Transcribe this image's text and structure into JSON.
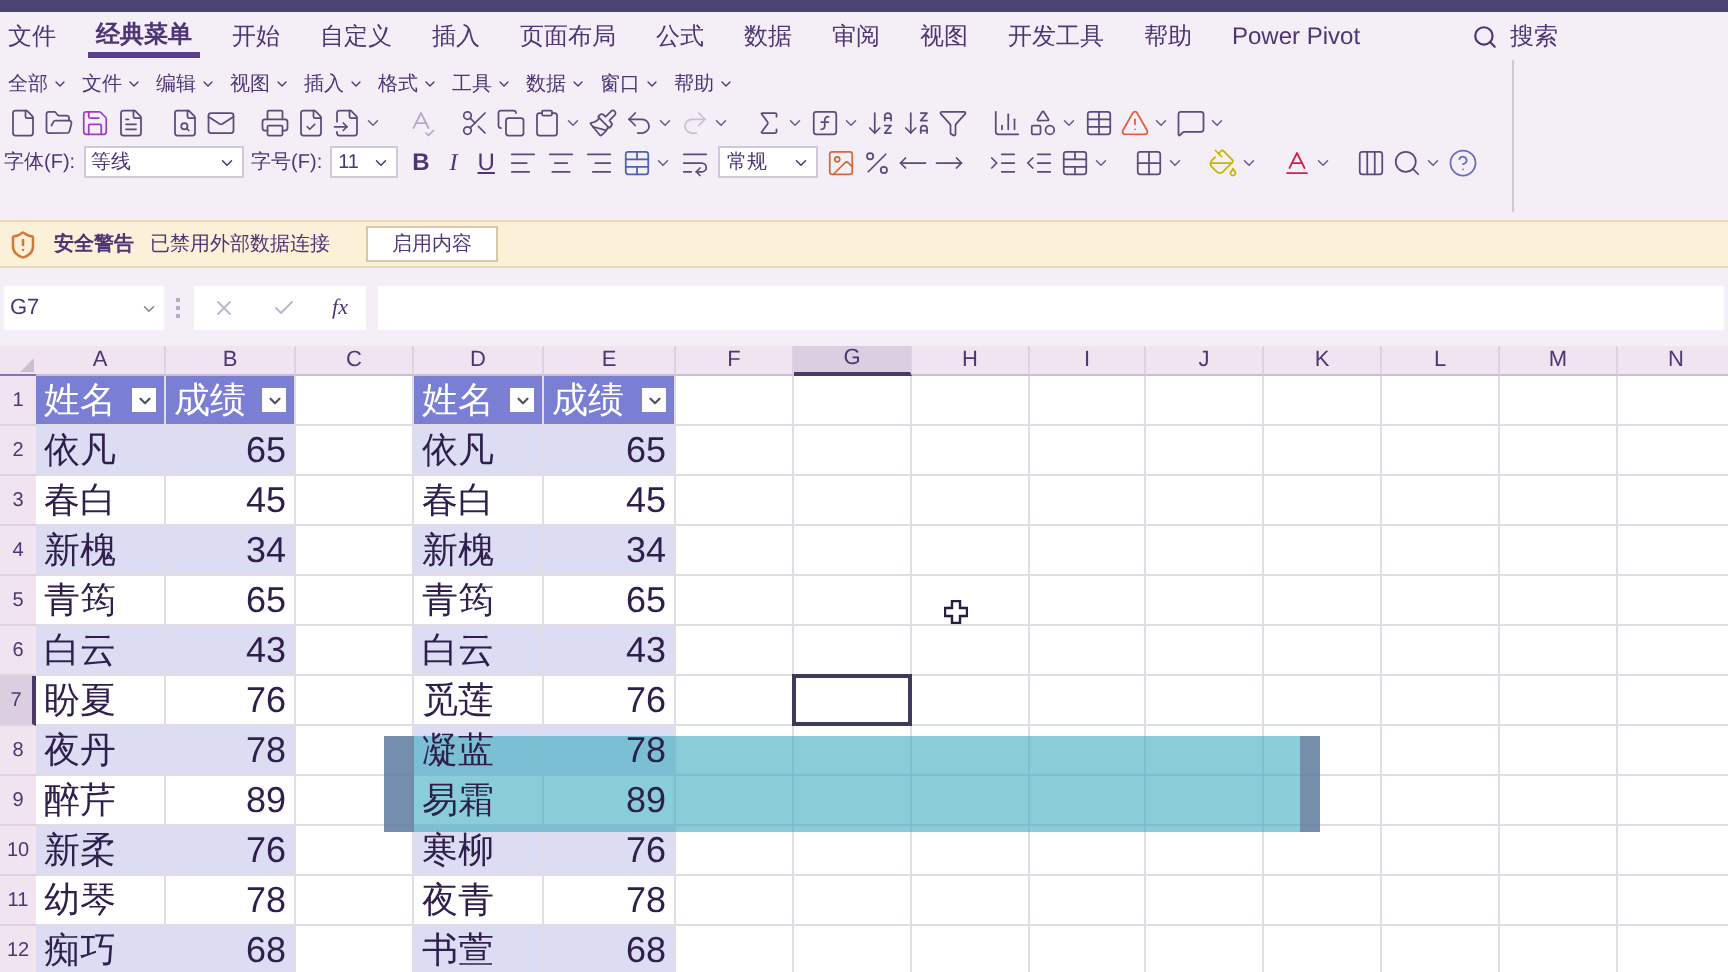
{
  "ribbon_tabs": [
    {
      "label": "文件",
      "selected": false
    },
    {
      "label": "经典菜单",
      "selected": true
    },
    {
      "label": "开始",
      "selected": false
    },
    {
      "label": "自定义",
      "selected": false
    },
    {
      "label": "插入",
      "selected": false
    },
    {
      "label": "页面布局",
      "selected": false
    },
    {
      "label": "公式",
      "selected": false
    },
    {
      "label": "数据",
      "selected": false
    },
    {
      "label": "审阅",
      "selected": false
    },
    {
      "label": "视图",
      "selected": false
    },
    {
      "label": "开发工具",
      "selected": false
    },
    {
      "label": "帮助",
      "selected": false
    },
    {
      "label": "Power Pivot",
      "selected": false
    }
  ],
  "search": {
    "label": "搜索"
  },
  "classic_menu": [
    "全部",
    "文件",
    "编辑",
    "视图",
    "插入",
    "格式",
    "工具",
    "数据",
    "窗口",
    "帮助"
  ],
  "font_toolbar": {
    "font_label": "字体(F):",
    "font": "等线",
    "size_label": "字号(F):",
    "size": "11",
    "bold": "B",
    "italic": "I",
    "underline": "U",
    "number_format": "常规"
  },
  "security_bar": {
    "title": "安全警告",
    "message": "已禁用外部数据连接",
    "button": "启用内容"
  },
  "formula_bar": {
    "name_box": "G7",
    "function_label": "fx"
  },
  "sheet": {
    "columns": [
      {
        "label": "A",
        "selected": false
      },
      {
        "label": "B",
        "selected": false
      },
      {
        "label": "C",
        "selected": false
      },
      {
        "label": "D",
        "selected": false
      },
      {
        "label": "E",
        "selected": false
      },
      {
        "label": "F",
        "selected": false
      },
      {
        "label": "G",
        "selected": true
      },
      {
        "label": "H",
        "selected": false
      },
      {
        "label": "I",
        "selected": false
      },
      {
        "label": "J",
        "selected": false
      },
      {
        "label": "K",
        "selected": false
      },
      {
        "label": "L",
        "selected": false
      },
      {
        "label": "M",
        "selected": false
      },
      {
        "label": "N",
        "selected": false
      }
    ],
    "rows": [
      {
        "label": "1",
        "selected": false
      },
      {
        "label": "2",
        "selected": false
      },
      {
        "label": "3",
        "selected": false
      },
      {
        "label": "4",
        "selected": false
      },
      {
        "label": "5",
        "selected": false
      },
      {
        "label": "6",
        "selected": false
      },
      {
        "label": "7",
        "selected": true
      },
      {
        "label": "8",
        "selected": false
      },
      {
        "label": "9",
        "selected": false
      },
      {
        "label": "10",
        "selected": false
      },
      {
        "label": "11",
        "selected": false
      },
      {
        "label": "12",
        "selected": false
      }
    ],
    "tables": [
      {
        "banded": true,
        "filter": true,
        "header": [
          "姓名",
          "成绩"
        ],
        "rows": [
          [
            "依凡",
            "65"
          ],
          [
            "春白",
            "45"
          ],
          [
            "新槐",
            "34"
          ],
          [
            "青筠",
            "65"
          ],
          [
            "白云",
            "43"
          ],
          [
            "盼夏",
            "76"
          ],
          [
            "夜丹",
            "78"
          ],
          [
            "醉芹",
            "89"
          ],
          [
            "新柔",
            "76"
          ],
          [
            "幼琴",
            "78"
          ],
          [
            "痴巧",
            "68"
          ]
        ]
      },
      {
        "banded": true,
        "filter": true,
        "header": [
          "姓名",
          "成绩"
        ],
        "rows": [
          [
            "依凡",
            "65"
          ],
          [
            "春白",
            "45"
          ],
          [
            "新槐",
            "34"
          ],
          [
            "青筠",
            "65"
          ],
          [
            "白云",
            "43"
          ],
          [
            "觅莲",
            "76"
          ],
          [
            "凝蓝",
            "78"
          ],
          [
            "易霜",
            "89"
          ],
          [
            "寒柳",
            "76"
          ],
          [
            "夜青",
            "78"
          ],
          [
            "书萱",
            "68"
          ]
        ]
      }
    ]
  }
}
